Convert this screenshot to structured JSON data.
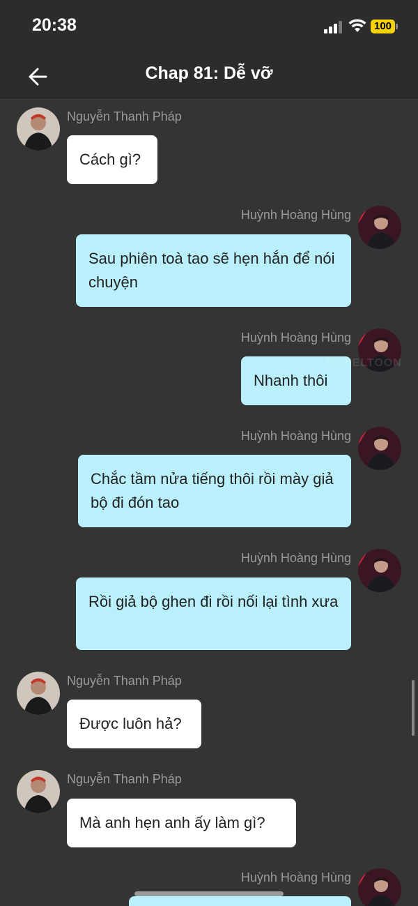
{
  "status_bar": {
    "time": "20:38",
    "battery": "100"
  },
  "nav": {
    "title": "Chap 81: Dễ vỡ"
  },
  "watermark": "NOVELTOON",
  "colors": {
    "background": "#343434",
    "incoming_bubble": "#ffffff",
    "outgoing_bubble": "#baf0fb",
    "battery": "#f5d20a"
  },
  "messages": [
    {
      "sender": "Nguyễn Thanh Pháp",
      "text": "Cách gì?"
    },
    {
      "sender": "Huỳnh Hoàng Hùng",
      "text": "Sau phiên toà tao sẽ hẹn hắn để nói chuyện"
    },
    {
      "sender": "Huỳnh Hoàng Hùng",
      "text": "Nhanh thôi"
    },
    {
      "sender": "Huỳnh Hoàng Hùng",
      "text": "Chắc tầm nửa tiếng thôi rồi mày giả bộ đi đón tao"
    },
    {
      "sender": "Huỳnh Hoàng Hùng",
      "text": "Rồi giả bộ ghen đi rồi nối lại tình xưa"
    },
    {
      "sender": "Nguyễn Thanh Pháp",
      "text": "Được luôn hả?"
    },
    {
      "sender": "Nguyễn Thanh Pháp",
      "text": "Mà anh hẹn anh ấy làm gì?"
    },
    {
      "sender": "Huỳnh Hoàng Hùng",
      "text": ""
    }
  ]
}
